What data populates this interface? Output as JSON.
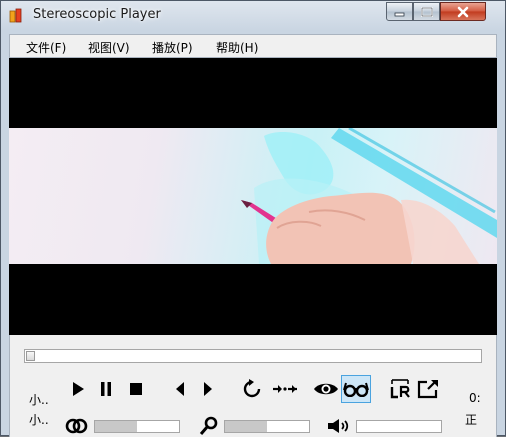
{
  "window": {
    "title": "Stereoscopic Player"
  },
  "menu": [
    {
      "label": "文件(F)"
    },
    {
      "label": "视图(V)"
    },
    {
      "label": "播放(P)"
    },
    {
      "label": "帮助(H)"
    }
  ],
  "playback": {
    "seek_position": 0.0
  },
  "status": {
    "left_top": "小..",
    "left_bottom": "小..",
    "right_top": "0:",
    "right_bottom": "正"
  },
  "sliders": {
    "parallax_fill": 0.5,
    "zoom_fill": 0.5,
    "volume_fill": 0.0
  },
  "icons": {
    "app": "stereo-player-icon",
    "play": "play-icon",
    "pause": "pause-icon",
    "stop": "stop-icon",
    "step_back": "step-back-icon",
    "step_forward": "step-forward-icon",
    "loop": "loop-icon",
    "swap": "swap-icon",
    "eye": "eye-icon",
    "glasses": "glasses-icon",
    "lr": "lr-swap-icon",
    "fullscreen": "fullscreen-icon",
    "parallax": "parallax-icon",
    "zoom": "zoom-icon",
    "volume": "volume-icon"
  }
}
